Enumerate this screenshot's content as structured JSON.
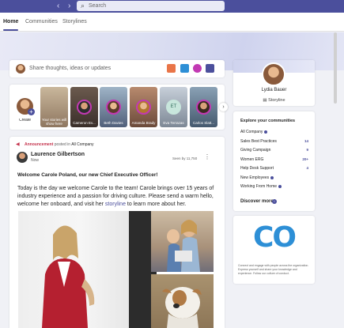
{
  "titlebar": {
    "back": "‹",
    "forward": "›",
    "search_placeholder": "Search"
  },
  "tabs": [
    {
      "label": "Home",
      "active": true
    },
    {
      "label": "Communities",
      "active": false
    },
    {
      "label": "Storylines",
      "active": false
    }
  ],
  "composer": {
    "placeholder": "Share thoughts, ideas or updates"
  },
  "stories": {
    "create_label": "Create",
    "items": [
      {
        "label": "Your stories will show here"
      },
      {
        "label": "Cameron Ev..."
      },
      {
        "label": "Beth Davies"
      },
      {
        "label": "Amanda Brady"
      },
      {
        "label": "Eva Terrazas",
        "initials": "ET"
      },
      {
        "label": "Carlos Slatt..."
      }
    ],
    "next": "›"
  },
  "post": {
    "announcement": "Announcement",
    "posted_in": "posted in",
    "community": "All Company",
    "author": "Laurence Gilbertson",
    "time": "Now",
    "seen": "Seen by 11,750",
    "more": "⋮",
    "headline": "Welcome Carole Poland, our new Chief Executive Officer!",
    "body_1": "Today is the day we welcome Carole to the team! Carole brings over 15 years of industry experience and a passion for driving culture. Please send a warm hello, welcome her onboard, and visit her ",
    "body_link": "storyline",
    "body_2": " to learn more about her."
  },
  "profile": {
    "name": "Lydia Bauer",
    "storyline": "Storyline"
  },
  "explore": {
    "title": "Explore your communities",
    "items": [
      {
        "name": "All Company",
        "count": "",
        "dot": true
      },
      {
        "name": "Sales Best Practices",
        "count": "14",
        "dot": false
      },
      {
        "name": "Giving Campaign",
        "count": "9",
        "dot": false
      },
      {
        "name": "Women ERG",
        "count": "20+",
        "dot": false
      },
      {
        "name": "Help Desk Support",
        "count": "4",
        "dot": false
      },
      {
        "name": "New Employees",
        "count": "",
        "dot": true
      },
      {
        "name": "Working From Home",
        "count": "",
        "dot": true
      }
    ],
    "discover_more": "Discover more",
    "discover_info": "i"
  },
  "discover_card": {
    "logo_text": "CO",
    "text": "Connect and engage with people across the organization. Express yourself and share your knowledge and experience. Follow our culture of conduct."
  },
  "colors": {
    "brand": "#4b4f9c",
    "announcement": "#c4314b",
    "link": "#4b4f9c",
    "logo": "#2d8fd6"
  }
}
